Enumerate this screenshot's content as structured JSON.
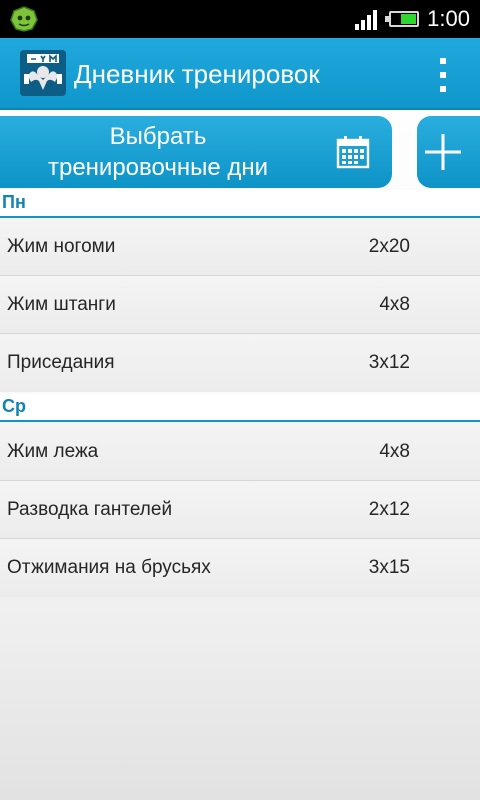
{
  "status_bar": {
    "time": "1:00",
    "battery_level": 0.6,
    "notification_icon": "android-robot-icon"
  },
  "app_bar": {
    "title": "Дневник тренировок",
    "logo_icon": "gym-logo-icon",
    "menu_icon": "overflow-menu-icon"
  },
  "toolbar": {
    "select_days_label": "Выбрать\nтренировочные дни",
    "calendar_icon": "calendar-icon",
    "add_icon": "plus-icon"
  },
  "colors": {
    "accent": "#1195c8",
    "header_text": "#1383b3",
    "status_bar": "#000000",
    "battery": "#2fd62f"
  },
  "days": [
    {
      "label": "Пн",
      "exercises": [
        {
          "name": "Жим ногоми",
          "sets": "2x20"
        },
        {
          "name": "Жим штанги",
          "sets": "4x8"
        },
        {
          "name": "Приседания",
          "sets": "3x12"
        }
      ]
    },
    {
      "label": "Ср",
      "exercises": [
        {
          "name": "Жим лежа",
          "sets": "4x8"
        },
        {
          "name": "Разводка гантелей",
          "sets": "2x12"
        },
        {
          "name": "Отжимания на брусьях",
          "sets": "3x15"
        }
      ]
    }
  ]
}
